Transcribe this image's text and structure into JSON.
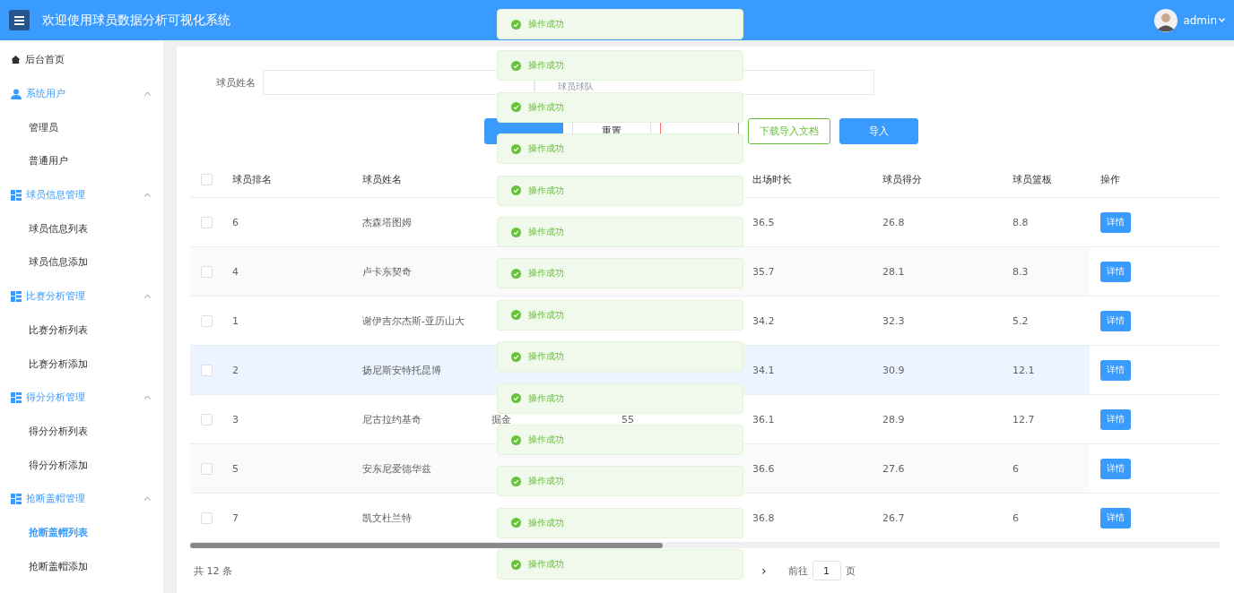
{
  "header": {
    "title": "欢迎使用球员数据分析可视化系统",
    "user": "admin"
  },
  "sidebar": {
    "items": [
      {
        "label": "后台首页",
        "kind": "home",
        "selected": false
      },
      {
        "label": "系统用户",
        "kind": "user",
        "expanded": true,
        "selected": false,
        "children": [
          {
            "label": "管理员",
            "selected": false
          },
          {
            "label": "普通用户",
            "selected": false
          }
        ]
      },
      {
        "label": "球员信息管理",
        "kind": "grid",
        "expanded": true,
        "selected": false,
        "children": [
          {
            "label": "球员信息列表",
            "selected": false
          },
          {
            "label": "球员信息添加",
            "selected": false
          }
        ]
      },
      {
        "label": "比赛分析管理",
        "kind": "grid",
        "expanded": true,
        "selected": false,
        "children": [
          {
            "label": "比赛分析列表",
            "selected": false
          },
          {
            "label": "比赛分析添加",
            "selected": false
          }
        ]
      },
      {
        "label": "得分分析管理",
        "kind": "grid",
        "expanded": true,
        "selected": false,
        "children": [
          {
            "label": "得分分析列表",
            "selected": false
          },
          {
            "label": "得分分析添加",
            "selected": false
          }
        ]
      },
      {
        "label": "抢断盖帽管理",
        "kind": "grid",
        "expanded": true,
        "selected": false,
        "children": [
          {
            "label": "抢断盖帽列表",
            "selected": true
          },
          {
            "label": "抢断盖帽添加",
            "selected": false
          }
        ]
      }
    ]
  },
  "search": {
    "label": "球员姓名",
    "team_placeholder": "球员球队"
  },
  "buttons": [
    {
      "kind": "primary"
    },
    {
      "label": "重置",
      "kind": "plain"
    },
    {
      "kind": "danger"
    },
    {
      "label": "下载导入文档",
      "kind": "success"
    },
    {
      "label": "导入",
      "kind": "primary"
    }
  ],
  "table": {
    "select_all_checked": false,
    "columns": [
      "球员排名",
      "球员姓名",
      "",
      "",
      "出场时长",
      "球员得分",
      "球员篮板",
      "操作"
    ],
    "rows": [
      {
        "cells": [
          "6",
          "杰森塔图姆",
          "",
          "",
          "36.5",
          "26.8",
          "8.8"
        ],
        "action": "详情",
        "checked": false,
        "highlighted": false
      },
      {
        "cells": [
          "4",
          "卢卡东契奇",
          "",
          "",
          "35.7",
          "28.1",
          "8.3"
        ],
        "action": "详情",
        "checked": false,
        "highlighted": false
      },
      {
        "cells": [
          "1",
          "谢伊吉尔杰斯-亚历山大",
          "",
          "",
          "34.2",
          "32.3",
          "5.2"
        ],
        "action": "详情",
        "checked": false,
        "highlighted": false
      },
      {
        "cells": [
          "2",
          "扬尼斯安特托昆博",
          "",
          "",
          "34.1",
          "30.9",
          "12.1"
        ],
        "action": "详情",
        "checked": false,
        "highlighted": true
      },
      {
        "cells": [
          "3",
          "尼古拉约基奇",
          "掘金",
          "55",
          "36.1",
          "28.9",
          "12.7"
        ],
        "action": "详情",
        "checked": false,
        "highlighted": false
      },
      {
        "cells": [
          "5",
          "安东尼爱德华兹",
          "",
          "",
          "36.6",
          "27.6",
          "6"
        ],
        "action": "详情",
        "checked": false,
        "highlighted": false
      },
      {
        "cells": [
          "7",
          "凯文杜兰特",
          "",
          "",
          "36.8",
          "26.7",
          "6"
        ],
        "action": "详情",
        "checked": false,
        "highlighted": false
      }
    ]
  },
  "pagination": {
    "total": "共 12 条",
    "next": "›",
    "goto_label": "前往",
    "page": "1",
    "page_suffix": "页"
  },
  "toasts": [
    "操作成功",
    "操作成功",
    "操作成功",
    "操作成功",
    "操作成功",
    "操作成功",
    "操作成功",
    "操作成功",
    "操作成功",
    "操作成功",
    "操作成功",
    "操作成功",
    "操作成功",
    "操作成功"
  ]
}
